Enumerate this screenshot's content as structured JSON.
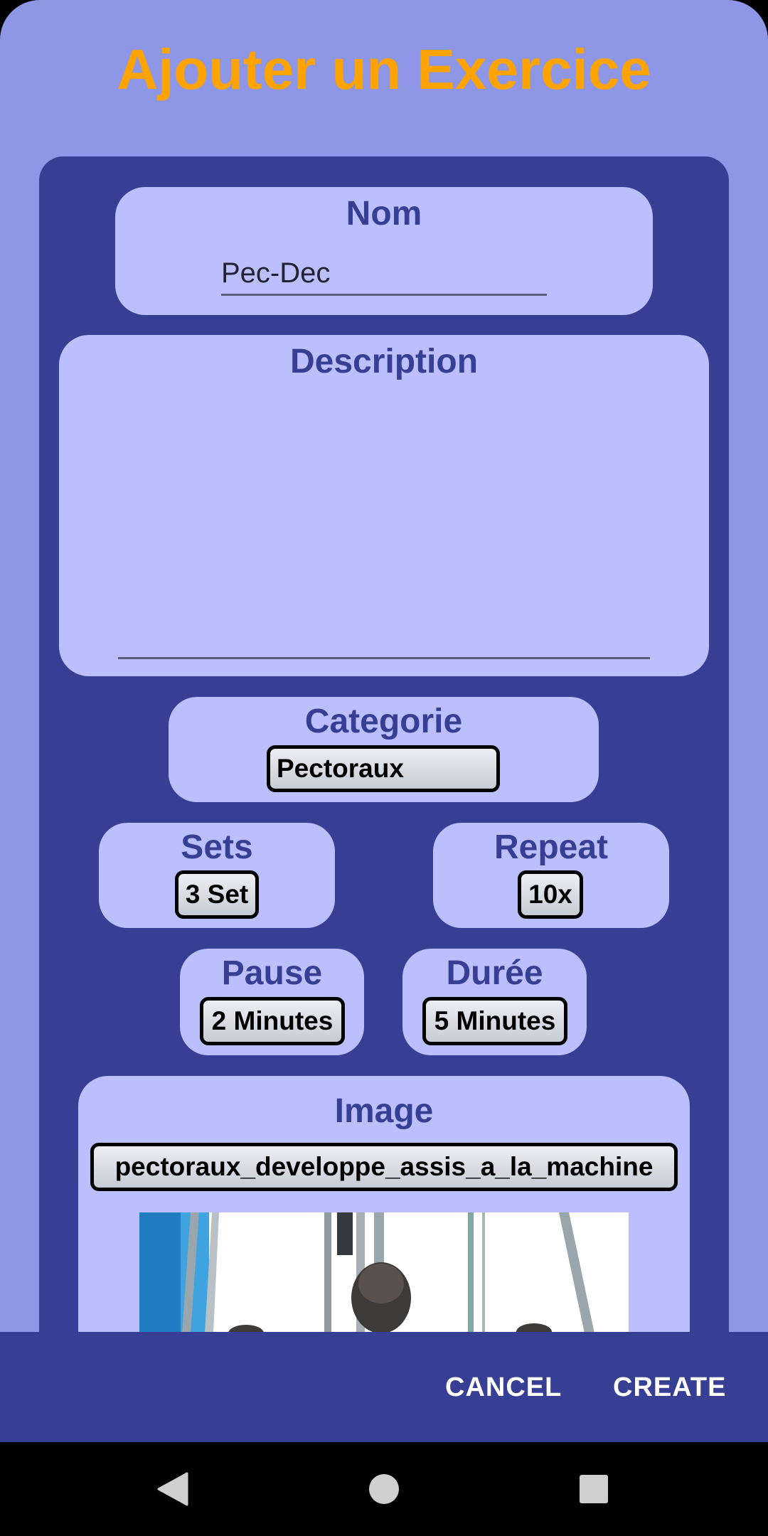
{
  "dialog": {
    "title": "Ajouter un Exercice"
  },
  "form": {
    "name": {
      "label": "Nom",
      "value": "Pec-Dec"
    },
    "description": {
      "label": "Description",
      "value": ""
    },
    "category": {
      "label": "Categorie",
      "selected": "Pectoraux"
    },
    "sets": {
      "label": "Sets",
      "selected": "3 Set"
    },
    "repeat": {
      "label": "Repeat",
      "selected": "10x"
    },
    "pause": {
      "label": "Pause",
      "selected": "2 Minutes"
    },
    "duration": {
      "label": "Durée",
      "selected": "5 Minutes"
    },
    "image": {
      "label": "Image",
      "selected": "pectoraux_developpe_assis_a_la_machine"
    }
  },
  "actions": {
    "cancel": "CANCEL",
    "create": "CREATE"
  },
  "colors": {
    "dialog_bg": "#8e96e6",
    "card_bg": "#373f94",
    "pill_bg": "#bbbffe",
    "title": "#ffa300",
    "label": "#373f94"
  },
  "nav": {
    "back_icon": "back-triangle-icon",
    "home_icon": "home-circle-icon",
    "recents_icon": "recents-square-icon"
  }
}
